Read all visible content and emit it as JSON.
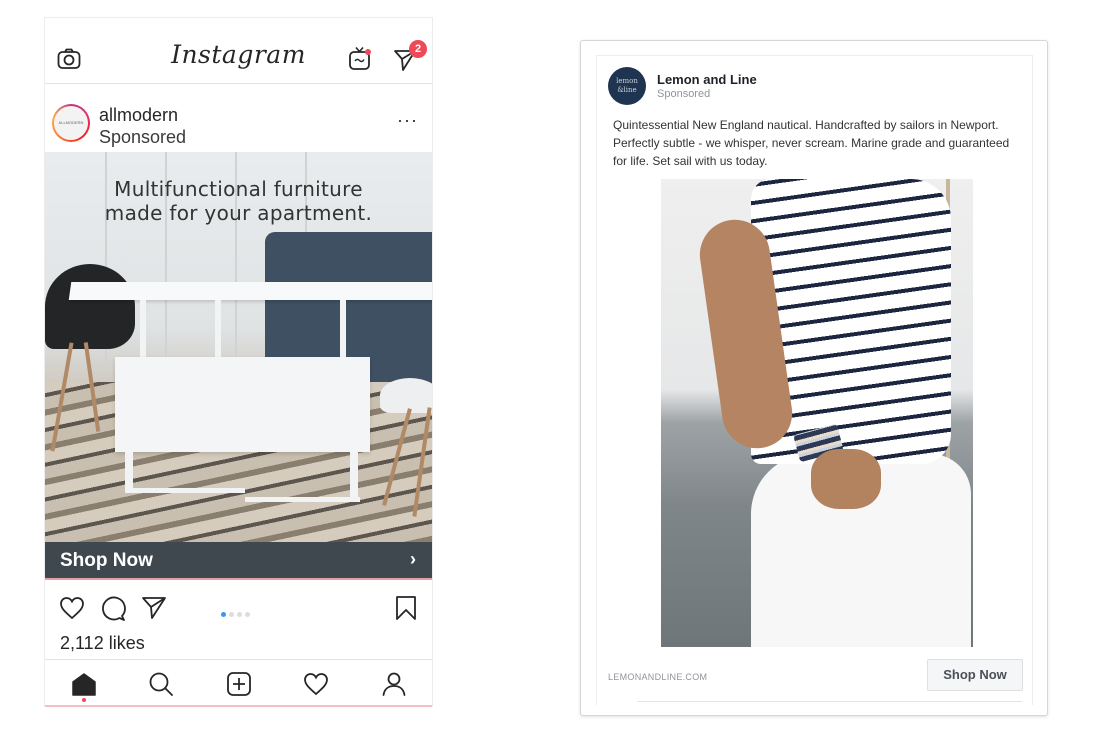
{
  "instagram": {
    "app_title": "Instagram",
    "icons": {
      "camera": "camera-icon",
      "igtv": "igtv-icon",
      "direct": "direct-message-icon"
    },
    "notification_count": "2",
    "post": {
      "username": "allmodern",
      "avatar_text": "ALLMODERN",
      "sponsored_label": "Sponsored",
      "more_label": "···",
      "image_headline_line1": "Multifunctional furniture",
      "image_headline_line2": "made for your apartment.",
      "cta_label": "Shop Now",
      "cta_chevron": "›",
      "carousel": {
        "total": 4,
        "active": 1
      },
      "likes": "2,112 likes"
    },
    "nav": [
      "home",
      "search",
      "new-post",
      "activity",
      "profile"
    ],
    "colors": {
      "accent": "#ed4956",
      "cta_bg": "#3f484f",
      "carousel_active": "#3897f0"
    }
  },
  "facebook": {
    "page_name": "Lemon and Line",
    "avatar_text_line1": "lemon",
    "avatar_text_line2": "&line",
    "sponsored_label": "Sponsored",
    "body_text": "Quintessential New England nautical. Handcrafted by sailors in Newport. Perfectly subtle - we whisper, never scream. Marine grade and guaranteed for life. Set sail with us today.",
    "link_domain": "LEMONANDLINE.COM",
    "cta_label": "Shop Now",
    "colors": {
      "avatar_bg": "#1f3450",
      "name": "#1d2129",
      "meta": "#90949c"
    }
  }
}
